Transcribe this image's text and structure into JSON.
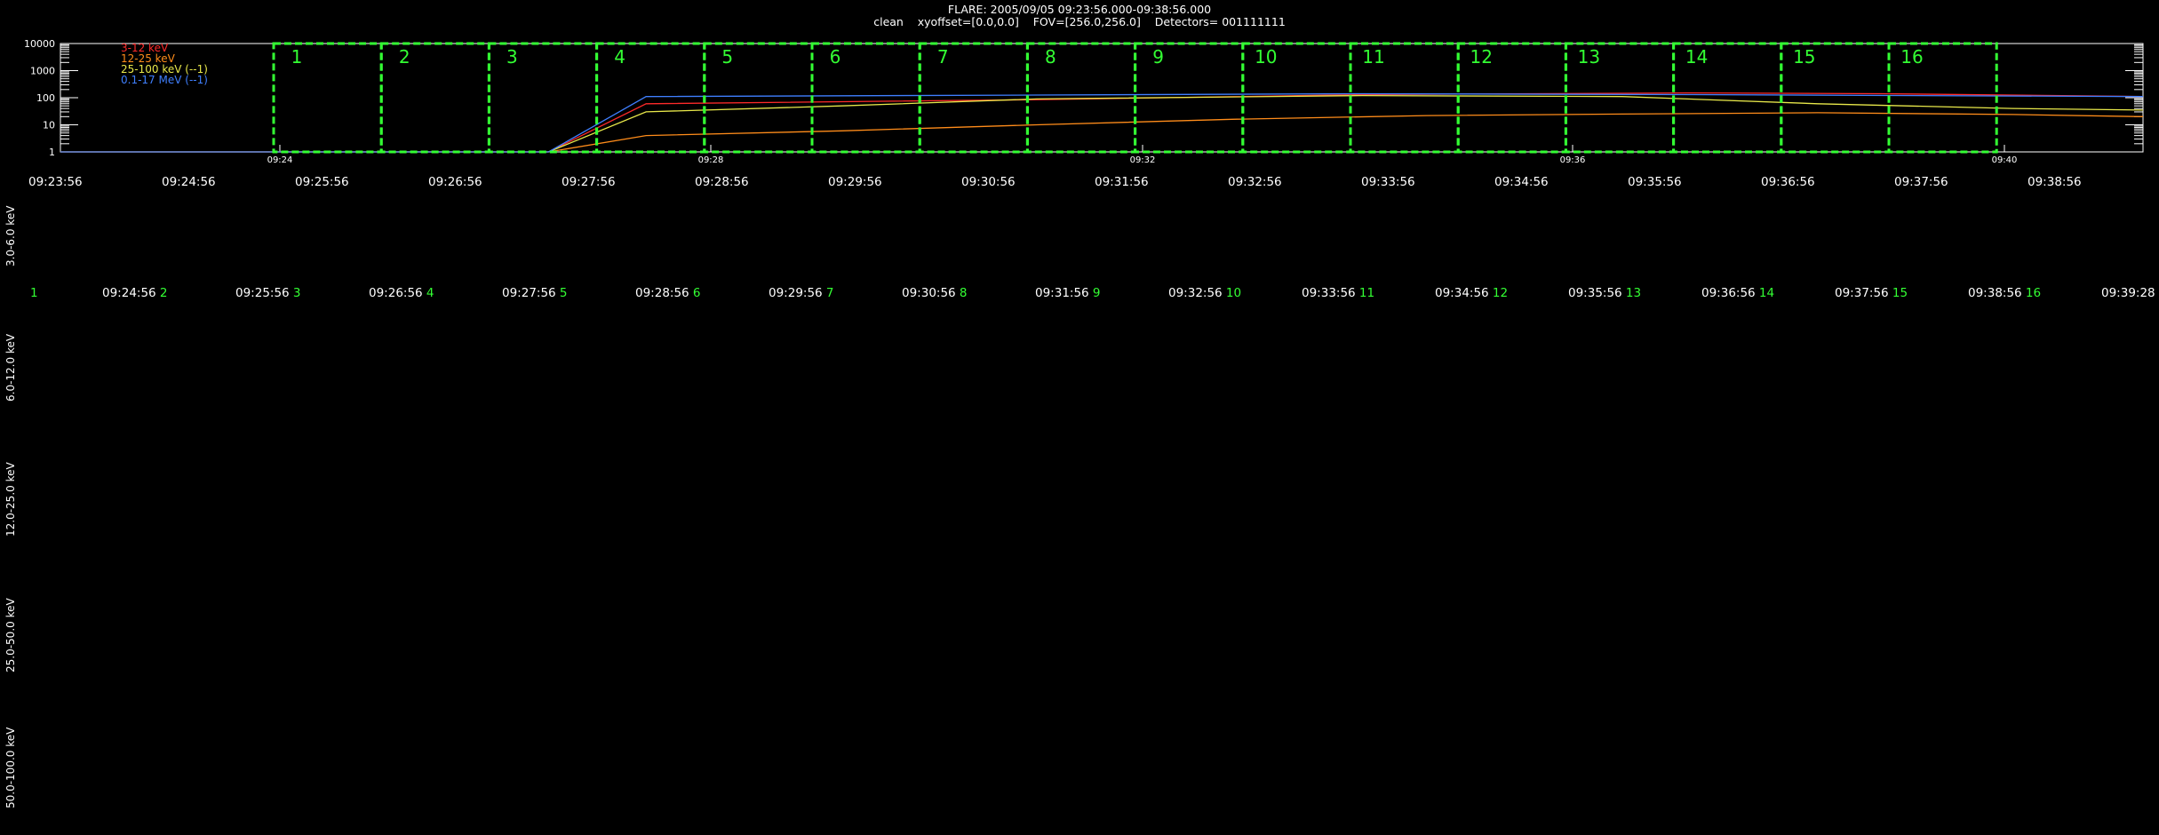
{
  "header": {
    "title_line": "FLARE: 2005/09/05 09:23:56.000-09:38:56.000",
    "params_line": "clean    xyoffset=[0.0,0.0]    FOV=[256.0,256.0]    Detectors= 001111111"
  },
  "chart_data": {
    "type": "line",
    "title": "FLARE: 2005/09/05 09:23:56.000-09:38:56.000",
    "y_scale": "log",
    "ylim": [
      1,
      10000
    ],
    "y_ticks": [
      "10000",
      "1000",
      "100",
      "10",
      "1"
    ],
    "x_ticks": [
      "09:24",
      "09:28",
      "09:32",
      "09:36",
      "09:40"
    ],
    "x_range_minutes": [
      9.4,
      9.72
    ],
    "legend": [
      "3-12 keV",
      "12-25 keV",
      "25-100 keV (--1)",
      "0.1-17 MeV (--1)"
    ],
    "legend_position": "top-left",
    "series": [
      {
        "name": "3-12 keV",
        "color": "#ff2a2a",
        "x": [
          9.4,
          9.475,
          9.49,
          9.55,
          9.6,
          9.65,
          9.68,
          9.72
        ],
        "y": [
          1,
          1,
          60,
          85,
          130,
          150,
          140,
          110
        ]
      },
      {
        "name": "12-25 keV",
        "color": "#ff8c1a",
        "x": [
          9.4,
          9.475,
          9.49,
          9.52,
          9.55,
          9.58,
          9.61,
          9.64,
          9.67,
          9.7,
          9.72
        ],
        "y": [
          1,
          1,
          4,
          6,
          10,
          16,
          22,
          25,
          28,
          24,
          20
        ]
      },
      {
        "name": "25-100 keV (--1)",
        "color": "#e8e84a",
        "x": [
          9.4,
          9.475,
          9.49,
          9.52,
          9.55,
          9.6,
          9.64,
          9.67,
          9.7,
          9.72
        ],
        "y": [
          1,
          1,
          30,
          50,
          90,
          120,
          110,
          60,
          40,
          35
        ]
      },
      {
        "name": "0.1-17 MeV (--1)",
        "color": "#3f7fff",
        "x": [
          9.4,
          9.475,
          9.49,
          9.55,
          9.6,
          9.65,
          9.72
        ],
        "y": [
          1,
          1,
          110,
          125,
          140,
          130,
          110
        ]
      }
    ],
    "intervals": [
      "1",
      "2",
      "3",
      "4",
      "5",
      "6",
      "7",
      "8",
      "9",
      "10",
      "11",
      "12",
      "13",
      "14",
      "15",
      "16"
    ]
  },
  "time_axis": [
    "09:23:56",
    "09:24:56",
    "09:25:56",
    "09:26:56",
    "09:27:56",
    "09:28:56",
    "09:29:56",
    "09:30:56",
    "09:31:56",
    "09:32:56",
    "09:33:56",
    "09:34:56",
    "09:35:56",
    "09:36:56",
    "09:37:56",
    "09:38:56"
  ],
  "interval_row": [
    {
      "n": "1",
      "t": ""
    },
    {
      "n": "2",
      "t": "09:24:56"
    },
    {
      "n": "3",
      "t": "09:25:56"
    },
    {
      "n": "4",
      "t": "09:26:56"
    },
    {
      "n": "5",
      "t": "09:27:56"
    },
    {
      "n": "6",
      "t": "09:28:56"
    },
    {
      "n": "7",
      "t": "09:29:56"
    },
    {
      "n": "8",
      "t": "09:30:56"
    },
    {
      "n": "9",
      "t": "09:31:56"
    },
    {
      "n": "10",
      "t": "09:32:56"
    },
    {
      "n": "11",
      "t": "09:33:56"
    },
    {
      "n": "12",
      "t": "09:34:56"
    },
    {
      "n": "13",
      "t": "09:35:56"
    },
    {
      "n": "14",
      "t": "09:36:56"
    },
    {
      "n": "15",
      "t": "09:37:56"
    },
    {
      "n": "16",
      "t": "09:38:56"
    },
    {
      "n": "",
      "t": "09:39:28"
    }
  ],
  "energy_rows": [
    "3.0-6.0 keV",
    "6.0-12.0 keV",
    "12.0-25.0 keV",
    "25.0-50.0 keV",
    "50.0-100.0 keV"
  ],
  "colors": {
    "interval_box": "#33ff33",
    "axis": "#ffffff",
    "background": "#000000"
  }
}
